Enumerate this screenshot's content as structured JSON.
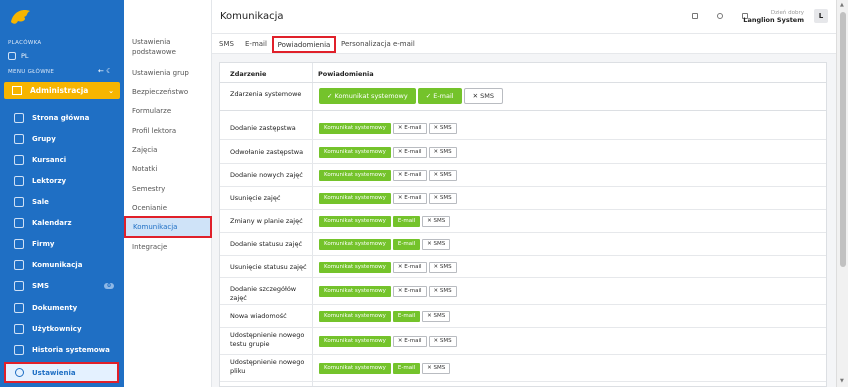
{
  "sidebar": {
    "section_label": "PLACÓWKA",
    "branch": "PL",
    "menu_label": "MENU GŁÓWNE",
    "admin_label": "Administracja",
    "items": [
      {
        "label": "Strona główna",
        "icon": "home-icon"
      },
      {
        "label": "Grupy",
        "icon": "groups-icon"
      },
      {
        "label": "Kursanci",
        "icon": "students-icon"
      },
      {
        "label": "Lektorzy",
        "icon": "teachers-icon"
      },
      {
        "label": "Sale",
        "icon": "rooms-icon"
      },
      {
        "label": "Kalendarz",
        "icon": "calendar-icon"
      },
      {
        "label": "Firmy",
        "icon": "companies-icon"
      },
      {
        "label": "Komunikacja",
        "icon": "mail-icon"
      },
      {
        "label": "SMS",
        "icon": "sms-icon",
        "badge": "0"
      },
      {
        "label": "Dokumenty",
        "icon": "documents-icon"
      },
      {
        "label": "Użytkownicy",
        "icon": "users-icon"
      },
      {
        "label": "Historia systemowa",
        "icon": "history-icon"
      }
    ],
    "settings_label": "Ustawienia"
  },
  "submenu": {
    "items": [
      "Ustawienia podstawowe",
      "Ustawienia grup",
      "Bezpieczeństwo",
      "Formularze",
      "Profil lektora",
      "Zajęcia",
      "Notatki",
      "Semestry",
      "Ocenianie",
      "Komunikacja",
      "Integracje"
    ]
  },
  "header": {
    "title": "Komunikacja",
    "greeting": "Dzień dobry",
    "user": "Langlion System",
    "avatar": "L"
  },
  "tabs": [
    "SMS",
    "E-mail",
    "Powiadomienia",
    "Personalizacja e-mail"
  ],
  "table": {
    "col1": "Zdarzenie",
    "col2": "Powiadomienia",
    "system_row": {
      "label": "Zdarzenia systemowe",
      "b1": "Komunikat systemowy",
      "b2": "E-mail",
      "b3": "SMS"
    },
    "rows": [
      {
        "label": "Dodanie zastępstwa",
        "email": false
      },
      {
        "label": "Odwołanie zastępstwa",
        "email": false
      },
      {
        "label": "Dodanie nowych zajęć",
        "email": false
      },
      {
        "label": "Usunięcie zajęć",
        "email": false
      },
      {
        "label": "Zmiany w planie zajęć",
        "email": true
      },
      {
        "label": "Dodanie statusu zajęć",
        "email": true
      },
      {
        "label": "Usunięcie statusu zajęć",
        "email": false
      },
      {
        "label": "Dodanie szczegółów zajęć",
        "email": false
      },
      {
        "label": "Nowa wiadomość",
        "email": true
      },
      {
        "label": "Udostępnienie nowego testu grupie",
        "email": false
      },
      {
        "label": "Udostępnienie nowego pliku",
        "email": true
      }
    ],
    "btn_system": "Komunikat systemowy",
    "btn_email": "E-mail",
    "btn_sms": "SMS"
  }
}
